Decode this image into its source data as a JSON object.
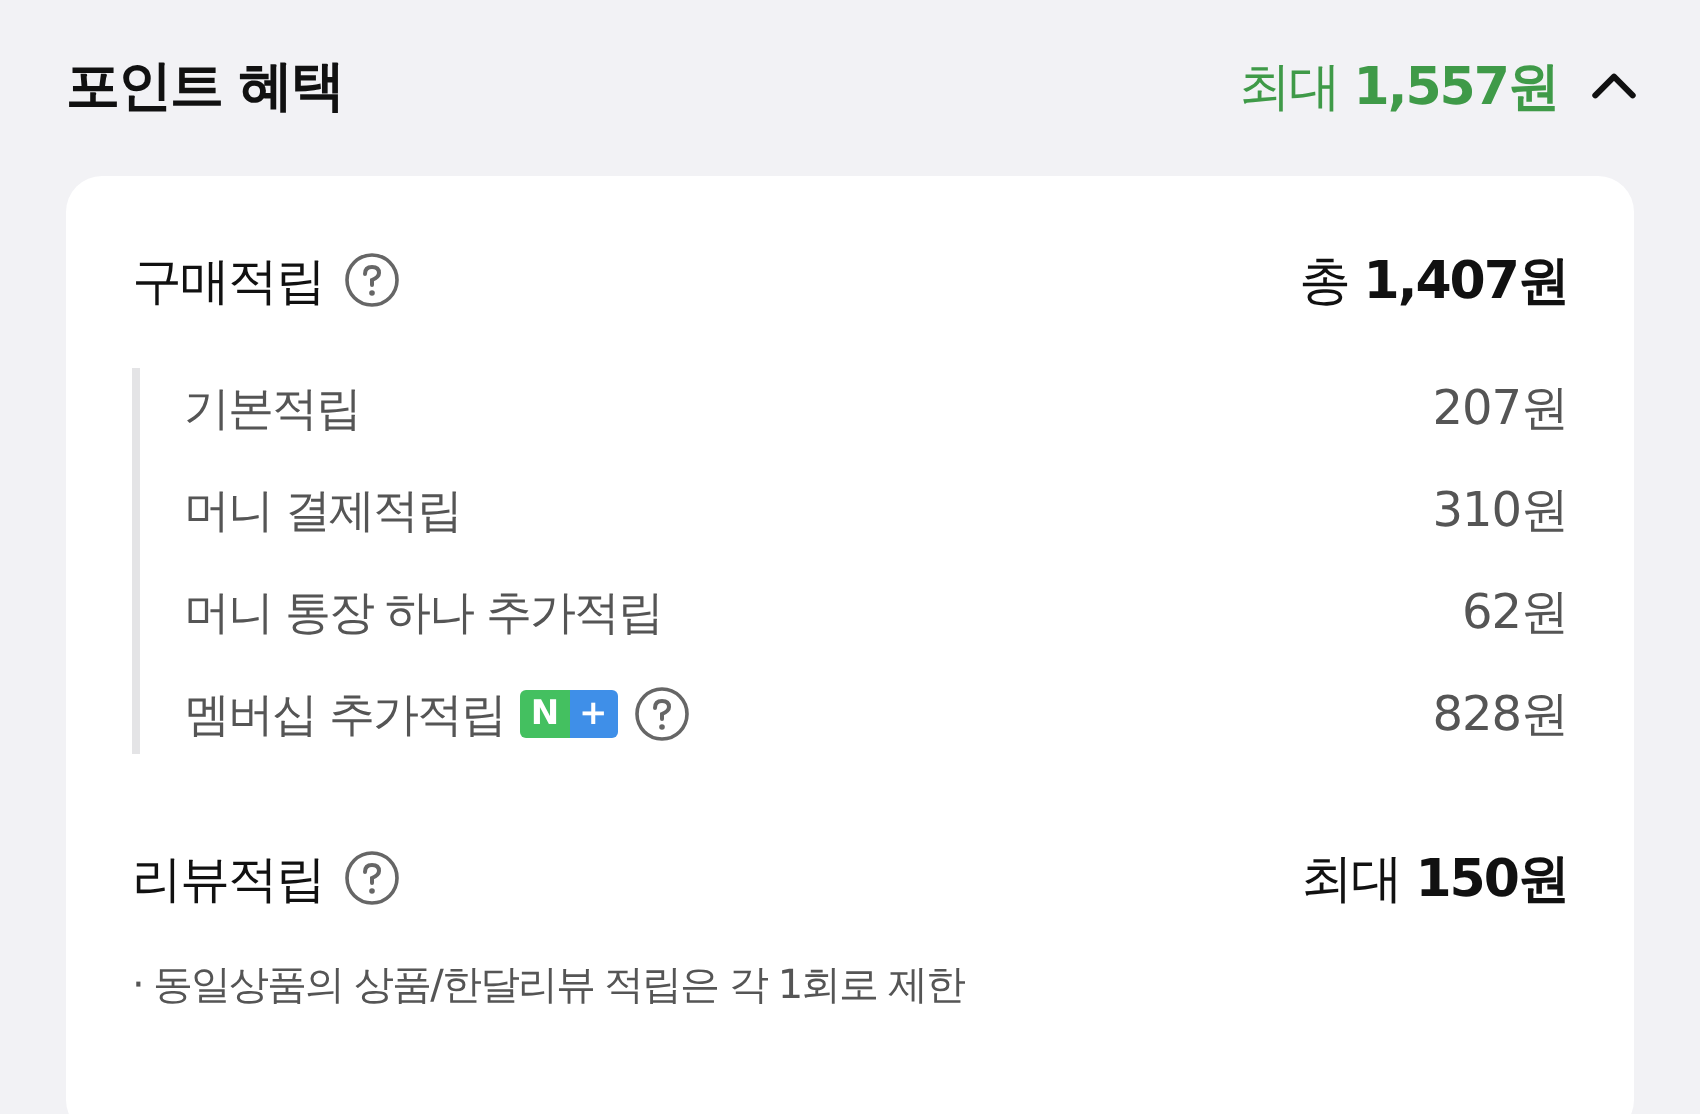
{
  "header": {
    "title": "포인트 혜택",
    "total": "최대 **1,557원**",
    "expanded": true
  },
  "sections": [
    {
      "title": "구매적립",
      "total": "총 **1,407원**",
      "items": [
        {
          "label": "기본적립",
          "value": "207원"
        },
        {
          "label": "머니 결제적립",
          "value": "310원"
        },
        {
          "label": "머니 통장 하나 추가적립",
          "value": "62원"
        },
        {
          "label": "멤버십 추가적립",
          "value": "828원",
          "badge": {
            "left": "N",
            "right": "+"
          },
          "help": true
        }
      ]
    },
    {
      "title": "리뷰적립",
      "total": "최대 **150원**",
      "note": "· 동일상품의 상품/한달리뷰 적립은 각 1회로 제한"
    }
  ]
}
